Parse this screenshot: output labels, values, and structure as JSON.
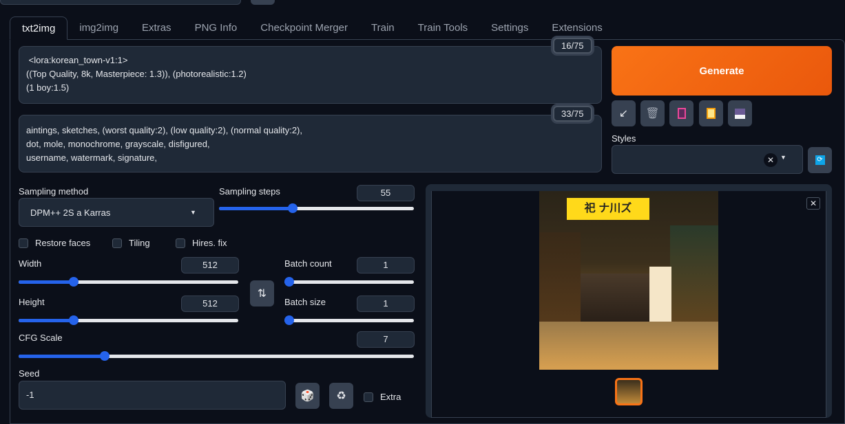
{
  "tabs": [
    "txt2img",
    "img2img",
    "Extras",
    "PNG Info",
    "Checkpoint Merger",
    "Train",
    "Train Tools",
    "Settings",
    "Extensions"
  ],
  "prompt": {
    "text": " <lora:korean_town-v1:1>\n((Top Quality, 8k, Masterpiece: 1.3)), (photorealistic:1.2)\n(1 boy:1.5)",
    "counter": "16/75"
  },
  "negative_prompt": {
    "text": "aintings, sketches, (worst quality:2), (low quality:2), (normal quality:2),\ndot, mole, monochrome, grayscale, disfigured,\nusername, watermark, signature,",
    "counter": "33/75"
  },
  "generate_label": "Generate",
  "styles_label": "Styles",
  "sampling": {
    "method_label": "Sampling method",
    "method_value": "DPM++ 2S a Karras",
    "steps_label": "Sampling steps",
    "steps": 55,
    "steps_fraction": 0.37
  },
  "checkboxes": {
    "restore_faces": "Restore faces",
    "tiling": "Tiling",
    "hires_fix": "Hires. fix",
    "extra": "Extra"
  },
  "width": {
    "label": "Width",
    "value": 512,
    "fraction": 0.24
  },
  "height": {
    "label": "Height",
    "value": 512,
    "fraction": 0.24
  },
  "batch_count": {
    "label": "Batch count",
    "value": 1,
    "fraction": 0
  },
  "batch_size": {
    "label": "Batch size",
    "value": 1,
    "fraction": 0
  },
  "cfg": {
    "label": "CFG Scale",
    "value": 7,
    "fraction": 0.21
  },
  "seed": {
    "label": "Seed",
    "value": "-1"
  },
  "sign_text": "祀 ナ川ズ"
}
